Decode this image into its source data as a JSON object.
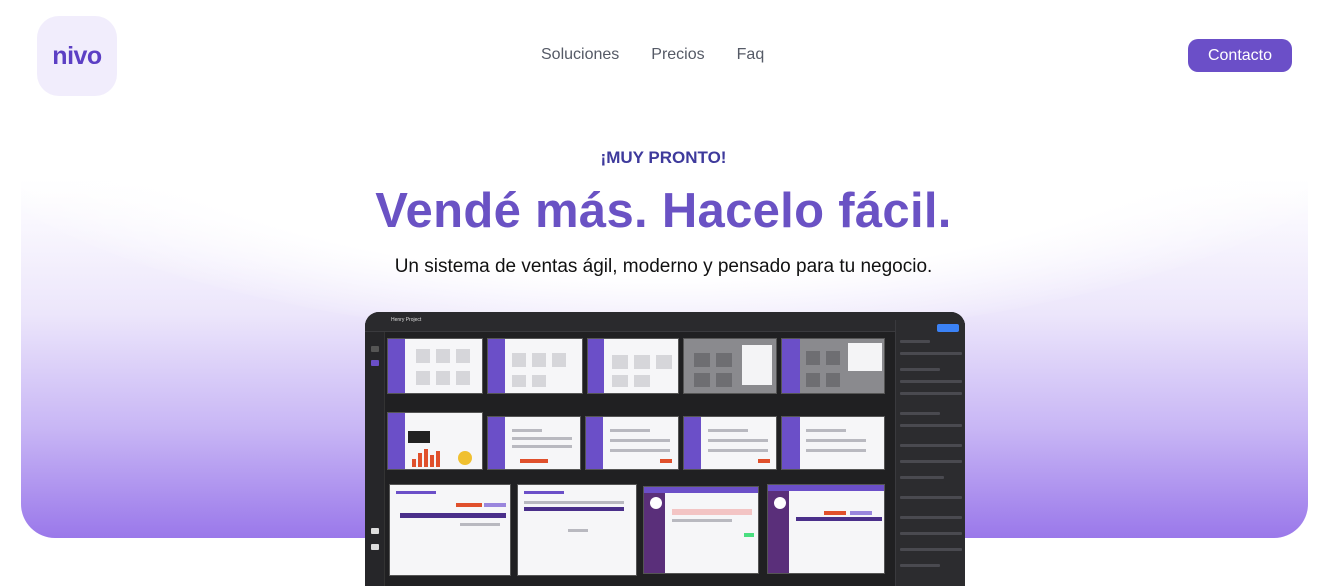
{
  "brand": {
    "logo_text": "nivo",
    "accent": "#6b4fc8"
  },
  "nav": {
    "items": [
      "Soluciones",
      "Precios",
      "Faq"
    ]
  },
  "header": {
    "contact_label": "Contacto"
  },
  "hero": {
    "eyebrow": "¡MUY PRONTO!",
    "headline": "Vendé más. Hacelo fácil.",
    "subheadline": "Un sistema de ventas ágil, moderno y pensado para tu negocio."
  },
  "mockup": {
    "project_title": "Henry Project",
    "share_label": "Compartir"
  }
}
